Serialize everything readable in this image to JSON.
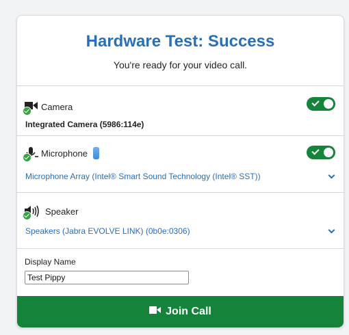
{
  "header": {
    "title": "Hardware Test: Success",
    "subtitle": "You're ready for your video call."
  },
  "camera": {
    "label": "Camera",
    "device": "Integrated Camera (5986:114e)",
    "enabled": true,
    "icon": "video-camera-icon"
  },
  "microphone": {
    "label": "Microphone",
    "device": "Microphone Array (Intel® Smart Sound Technology (Intel® SST))",
    "enabled": true,
    "icon": "microphone-icon"
  },
  "speaker": {
    "label": "Speaker",
    "device": "Speakers (Jabra EVOLVE LINK) (0b0e:0306)",
    "icon": "speaker-icon"
  },
  "display_name": {
    "label": "Display Name",
    "value": "Test Pippy"
  },
  "join": {
    "label": "Join Call"
  },
  "colors": {
    "accent": "#2a6fb5",
    "success": "#15843b",
    "check": "#3aa046"
  }
}
